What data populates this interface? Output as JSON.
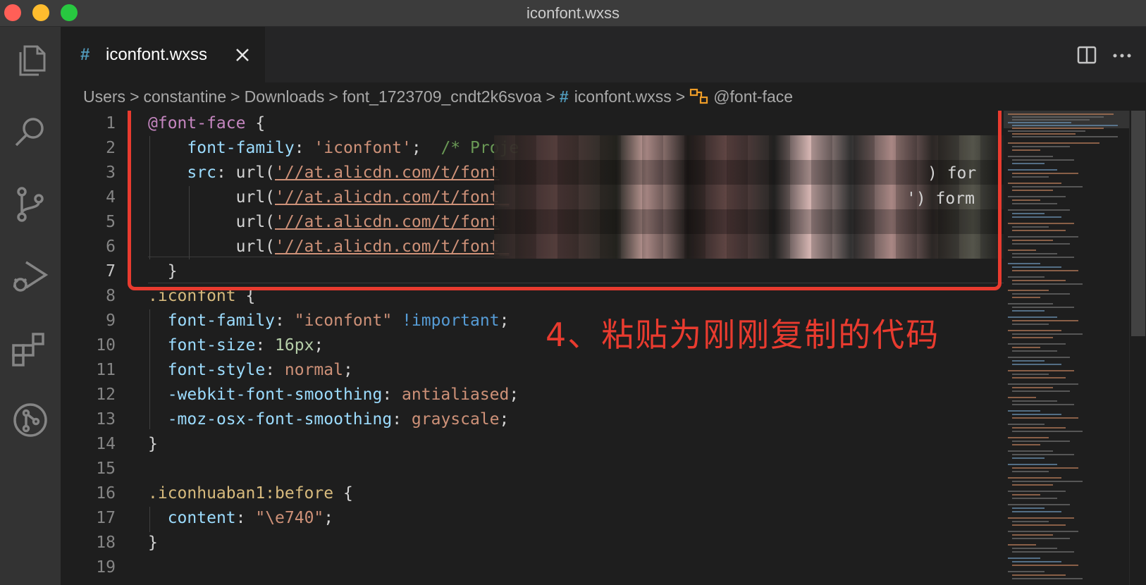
{
  "window": {
    "title": "iconfont.wxss"
  },
  "tab": {
    "hash": "#",
    "label": "iconfont.wxss"
  },
  "breadcrumb": {
    "items": [
      "Users",
      "constantine",
      "Downloads",
      "font_1723709_cndt2k6svoa"
    ],
    "file_hash": "#",
    "file": "iconfont.wxss",
    "symbol": "@font-face"
  },
  "editor": {
    "lines": [
      {
        "n": "1",
        "tokens": [
          [
            "at",
            "@font-face"
          ],
          [
            "punc",
            " {"
          ]
        ]
      },
      {
        "n": "2",
        "tokens": [
          [
            "plain",
            "    "
          ],
          [
            "prop",
            "font-family"
          ],
          [
            "punc",
            ": "
          ],
          [
            "str",
            "'iconfont'"
          ],
          [
            "punc",
            ";  "
          ],
          [
            "com",
            "/* Proje"
          ]
        ]
      },
      {
        "n": "3",
        "tokens": [
          [
            "plain",
            "    "
          ],
          [
            "prop",
            "src"
          ],
          [
            "punc",
            ": url("
          ],
          [
            "url",
            "'//at.alicdn.com/t/font"
          ]
        ]
      },
      {
        "n": "4",
        "tokens": [
          [
            "plain",
            "         url("
          ],
          [
            "url",
            "'//at.alicdn.com/t/font_"
          ]
        ]
      },
      {
        "n": "5",
        "tokens": [
          [
            "plain",
            "         url("
          ],
          [
            "url",
            "'//at.alicdn.com/t/font"
          ]
        ]
      },
      {
        "n": "6",
        "tokens": [
          [
            "plain",
            "         url("
          ],
          [
            "url",
            "'//at.alicdn.com/t/font_"
          ]
        ]
      },
      {
        "n": "7",
        "tokens": [
          [
            "plain",
            "  "
          ],
          [
            "punc",
            "}"
          ]
        ]
      },
      {
        "n": "8",
        "tokens": [
          [
            "sel",
            ".iconfont"
          ],
          [
            "punc",
            " {"
          ]
        ]
      },
      {
        "n": "9",
        "tokens": [
          [
            "plain",
            "  "
          ],
          [
            "prop",
            "font-family"
          ],
          [
            "punc",
            ": "
          ],
          [
            "str",
            "\"iconfont\""
          ],
          [
            "punc",
            " "
          ],
          [
            "imp",
            "!important"
          ],
          [
            "punc",
            ";"
          ]
        ]
      },
      {
        "n": "10",
        "tokens": [
          [
            "plain",
            "  "
          ],
          [
            "prop",
            "font-size"
          ],
          [
            "punc",
            ": "
          ],
          [
            "num",
            "16px"
          ],
          [
            "punc",
            ";"
          ]
        ]
      },
      {
        "n": "11",
        "tokens": [
          [
            "plain",
            "  "
          ],
          [
            "prop",
            "font-style"
          ],
          [
            "punc",
            ": "
          ],
          [
            "str",
            "normal"
          ],
          [
            "punc",
            ";"
          ]
        ]
      },
      {
        "n": "12",
        "tokens": [
          [
            "plain",
            "  "
          ],
          [
            "prop",
            "-webkit-font-smoothing"
          ],
          [
            "punc",
            ": "
          ],
          [
            "str",
            "antialiased"
          ],
          [
            "punc",
            ";"
          ]
        ]
      },
      {
        "n": "13",
        "tokens": [
          [
            "plain",
            "  "
          ],
          [
            "prop",
            "-moz-osx-font-smoothing"
          ],
          [
            "punc",
            ": "
          ],
          [
            "str",
            "grayscale"
          ],
          [
            "punc",
            ";"
          ]
        ]
      },
      {
        "n": "14",
        "tokens": [
          [
            "punc",
            "}"
          ]
        ]
      },
      {
        "n": "15",
        "tokens": []
      },
      {
        "n": "16",
        "tokens": [
          [
            "sel",
            ".iconhuaban1:before"
          ],
          [
            "punc",
            " {"
          ]
        ]
      },
      {
        "n": "17",
        "tokens": [
          [
            "plain",
            "  "
          ],
          [
            "prop",
            "content"
          ],
          [
            "punc",
            ": "
          ],
          [
            "str",
            "\"\\e740\""
          ],
          [
            "punc",
            ";"
          ]
        ]
      },
      {
        "n": "18",
        "tokens": [
          [
            "punc",
            "}"
          ]
        ]
      },
      {
        "n": "19",
        "tokens": []
      }
    ],
    "line3_tail": ") for",
    "line4_tail": "') form"
  },
  "annotation": {
    "text": "4、粘贴为刚刚复制的代码",
    "color": "#e93b2f"
  },
  "icons": {
    "activity": [
      "explorer-icon",
      "search-icon",
      "source-control-icon",
      "run-debug-icon",
      "extensions-icon",
      "git-graph-icon"
    ],
    "tab_close": "close-icon",
    "split": "split-editor-icon",
    "more": "more-actions-icon"
  }
}
